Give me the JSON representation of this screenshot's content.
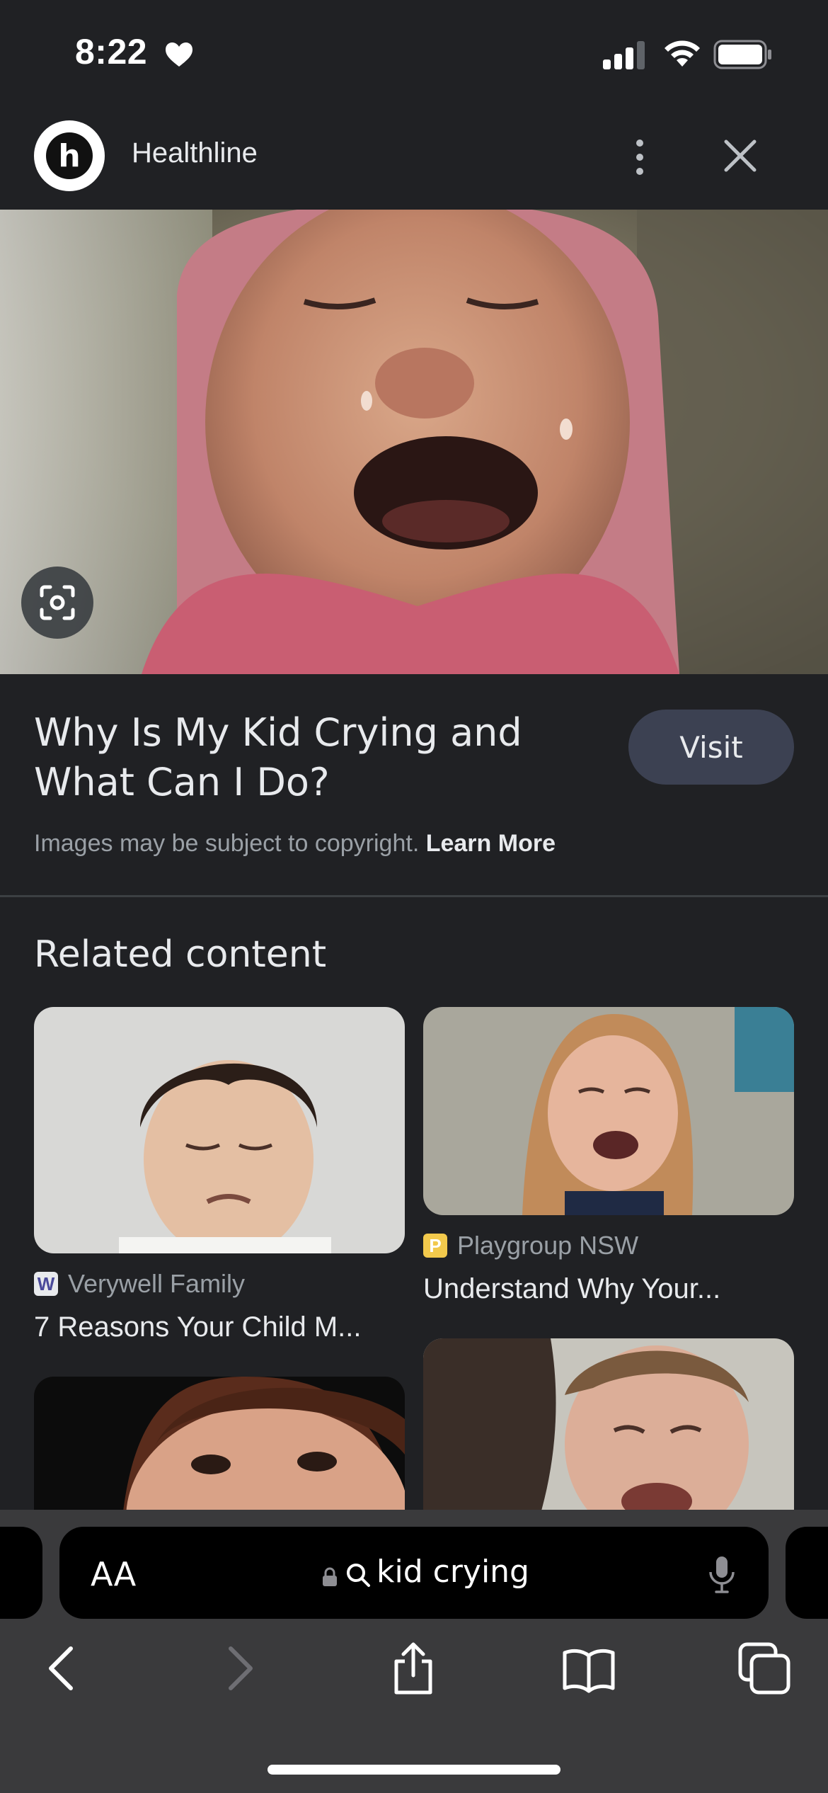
{
  "status": {
    "time": "8:22"
  },
  "source": {
    "name": "Healthline",
    "logo_letter": "h"
  },
  "result": {
    "title": "Why Is My Kid Crying and What Can I Do?",
    "visit_label": "Visit",
    "copyright_text": "Images may be subject to copyright.",
    "learn_more": "Learn More"
  },
  "related": {
    "heading": "Related content",
    "items": [
      {
        "source": "Verywell Family",
        "favicon": "W",
        "title": "7 Reasons Your Child M..."
      },
      {
        "source": "Playgroup NSW",
        "favicon": "P",
        "title": "Understand Why Your..."
      }
    ]
  },
  "browser": {
    "aa_label": "AA",
    "url_text": "kid crying"
  },
  "colors": {
    "background": "#202124",
    "visit_button": "#3c4152",
    "toolbar": "#3a3a3c"
  }
}
